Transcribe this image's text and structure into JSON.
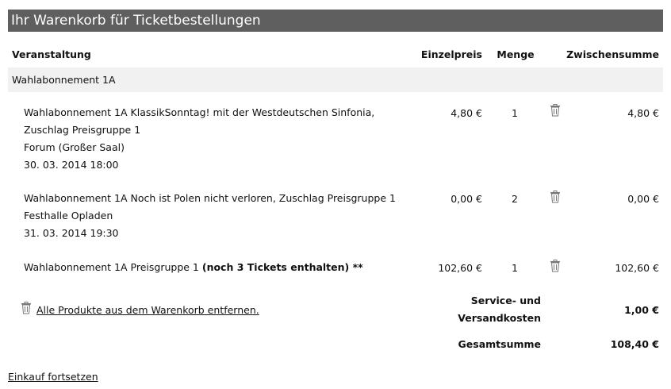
{
  "header": {
    "title": "Ihr Warenkorb für Ticketbestellungen"
  },
  "columns": {
    "event": "Veranstaltung",
    "unit_price": "Einzelpreis",
    "quantity": "Menge",
    "subtotal": "Zwischensumme"
  },
  "group": {
    "label": "Wahlabonnement 1A"
  },
  "items": [
    {
      "title": "Wahlabonnement 1A KlassikSonntag! mit der Westdeutschen Sinfonia, Zuschlag Preisgruppe 1",
      "venue": "Forum (Großer Saal)",
      "datetime": "30. 03. 2014 18:00",
      "unit_price": "4,80 €",
      "quantity": "1",
      "subtotal": "4,80 €"
    },
    {
      "title": "Wahlabonnement 1A Noch ist Polen nicht verloren, Zuschlag Preisgruppe 1",
      "venue": "Festhalle Opladen",
      "datetime": "31. 03. 2014 19:30",
      "unit_price": "0,00 €",
      "quantity": "2",
      "subtotal": "0,00 €"
    },
    {
      "title": "Wahlabonnement 1A Preisgruppe 1",
      "note": "(noch 3 Tickets enthalten) **",
      "unit_price": "102,60 €",
      "quantity": "1",
      "subtotal": "102,60 €"
    }
  ],
  "actions": {
    "remove_all": "Alle Produkte aus dem Warenkorb entfernen.",
    "continue_shopping": "Einkauf fortsetzen"
  },
  "totals": {
    "service_label_line1": "Service- und",
    "service_label_line2": "Versandkosten",
    "service_value": "1,00 €",
    "grand_label": "Gesamtsumme",
    "grand_value": "108,40 €"
  },
  "icons": {
    "trash": "trash-icon"
  }
}
